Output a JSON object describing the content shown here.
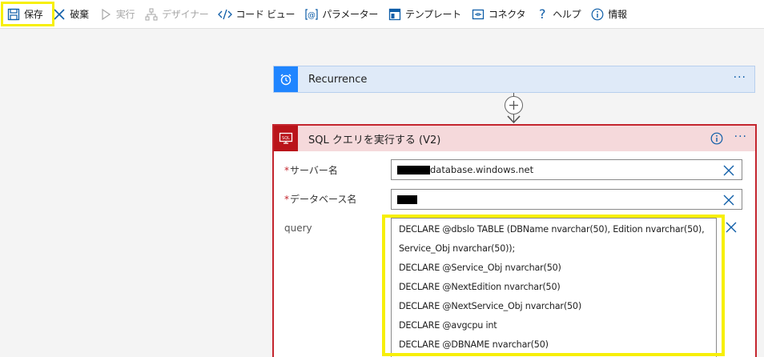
{
  "toolbar": {
    "items": [
      {
        "label": "保存",
        "icon": "save-icon"
      },
      {
        "label": "破棄",
        "icon": "discard-icon"
      },
      {
        "label": "実行",
        "icon": "run-icon"
      },
      {
        "label": "デザイナー",
        "icon": "designer-icon"
      },
      {
        "label": "コード ビュー",
        "icon": "code-view-icon"
      },
      {
        "label": "パラメーター",
        "icon": "parameters-icon"
      },
      {
        "label": "テンプレート",
        "icon": "templates-icon"
      },
      {
        "label": "コネクタ",
        "icon": "connectors-icon"
      },
      {
        "label": "ヘルプ",
        "icon": "help-icon"
      },
      {
        "label": "情報",
        "icon": "info-icon"
      }
    ]
  },
  "recurrence": {
    "title": "Recurrence",
    "icon": "alarm-clock-icon",
    "menu": "···"
  },
  "sql_action": {
    "title": "SQL クエリを実行する (V2)",
    "icon": "sql-icon",
    "menu": "···",
    "fields": {
      "server": {
        "label": "サーバー名",
        "required_mark": "*",
        "value_suffix": "database.windows.net"
      },
      "database": {
        "label": "データベース名",
        "required_mark": "*"
      },
      "query": {
        "label": "query",
        "lines": [
          "DECLARE @dbslo TABLE (DBName nvarchar(50), Edition nvarchar(50),",
          "Service_Obj nvarchar(50));",
          "DECLARE @Service_Obj nvarchar(50)",
          "DECLARE @NextEdition nvarchar(50)",
          "DECLARE @NextService_Obj nvarchar(50)",
          "DECLARE @avgcpu int",
          "DECLARE @DBNAME nvarchar(50)"
        ]
      }
    }
  },
  "colors": {
    "accent_blue": "#1f85ff",
    "sql_red": "#c4252e",
    "highlight_yellow": "#f7ef08"
  }
}
